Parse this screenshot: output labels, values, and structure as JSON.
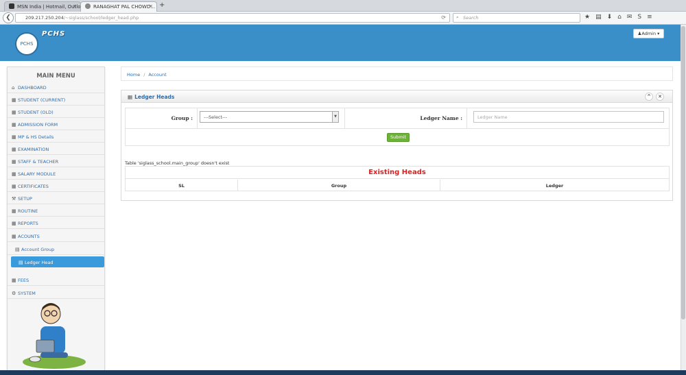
{
  "browser": {
    "tabs": [
      {
        "label": "MSN India | Hotmail, Outlo...",
        "active": false
      },
      {
        "label": "RANAGHAT PAL CHOWD...",
        "active": true
      }
    ],
    "close_glyph": "×",
    "newtab_glyph": "+",
    "back_glyph": "❮",
    "url_host": "209.217.250.204",
    "url_path": "/~siglass/school/ledger_head.php",
    "reload_glyph": "⟳",
    "search_placeholder": "Search",
    "toolbar_icons": [
      "★",
      "▤",
      "⬇",
      "⌂",
      "✉",
      "S",
      "≡"
    ]
  },
  "header": {
    "brand": "PCHS",
    "logo_text": "PCHS",
    "admin_label": "Admin",
    "bg_color": "#3a8fc9"
  },
  "sidebar": {
    "title": "MAIN MENU",
    "items": [
      {
        "label": "DASHBOARD",
        "icon": "home-icon"
      },
      {
        "label": "STUDENT (CURRENT)",
        "icon": "grid-icon"
      },
      {
        "label": "STUDENT (OLD)",
        "icon": "grid-icon"
      },
      {
        "label": "ADMISSION FORM",
        "icon": "grid-icon"
      },
      {
        "label": "MP & HS Details",
        "icon": "grid-icon"
      },
      {
        "label": "EXAMINATION",
        "icon": "grid-icon"
      },
      {
        "label": "STAFF & TEACHER",
        "icon": "grid-icon"
      },
      {
        "label": "SALARY MODULE",
        "icon": "grid-icon"
      },
      {
        "label": "CERTIFICATES",
        "icon": "grid-icon"
      },
      {
        "label": "SETUP",
        "icon": "wrench-icon"
      },
      {
        "label": "ROUTINE",
        "icon": "grid-icon"
      },
      {
        "label": "REPORTS",
        "icon": "grid-icon"
      },
      {
        "label": "ACOUNTS",
        "icon": "grid-icon"
      },
      {
        "label": "Account Group",
        "icon": "list-icon"
      },
      {
        "label": "Ledger Head",
        "icon": "list-icon"
      },
      {
        "label": "FEES",
        "icon": "grid-icon"
      },
      {
        "label": "SYSTEM",
        "icon": "cogs-icon"
      }
    ],
    "active_color": "#3a9bdc"
  },
  "breadcrumb": {
    "home": "Home",
    "separator": "/",
    "current": "Account"
  },
  "panel": {
    "title": "Ledger Heads",
    "collapse_glyph": "^",
    "close_glyph": "✕",
    "group_label": "Group :",
    "group_value": "---Select---",
    "ledger_label": "Ledger Name :",
    "ledger_placeholder": "Ledger Name",
    "submit_label": "Submit",
    "error_text": "Table 'siglass_school.main_group' doesn't exist",
    "table_title": "Existing Heads",
    "columns": [
      "SL",
      "Group",
      "Ledger"
    ]
  }
}
